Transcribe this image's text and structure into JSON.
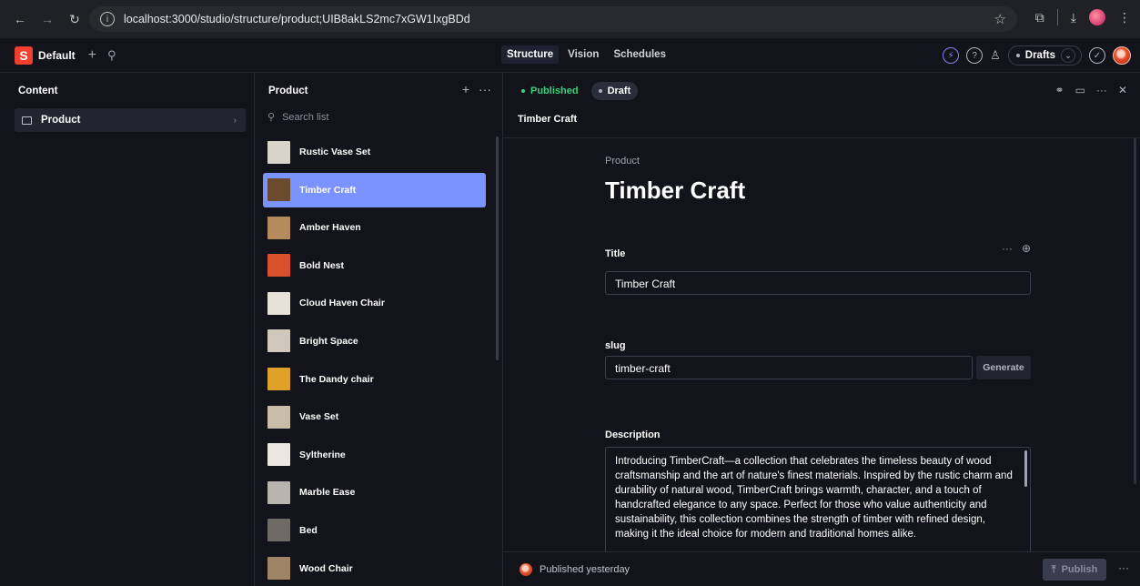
{
  "browser": {
    "url": "localhost:3000/studio/structure/product;UIB8akLS2mc7xGW1IxgBDd"
  },
  "app": {
    "workspace": "Default",
    "tabs": [
      "Structure",
      "Vision",
      "Schedules"
    ],
    "perspective": "Drafts"
  },
  "content_pane": {
    "title": "Content",
    "items": [
      {
        "label": "Product"
      }
    ]
  },
  "product_pane": {
    "title": "Product",
    "search_placeholder": "Search list",
    "items": [
      {
        "label": "Rustic Vase Set",
        "thumb": "#d8d4cc"
      },
      {
        "label": "Timber Craft",
        "thumb": "#6b4a2e",
        "selected": true
      },
      {
        "label": "Amber Haven",
        "thumb": "#b58a5c"
      },
      {
        "label": "Bold Nest",
        "thumb": "#d9502c"
      },
      {
        "label": "Cloud Haven Chair",
        "thumb": "#e6e2da"
      },
      {
        "label": "Bright Space",
        "thumb": "#cfc8bb"
      },
      {
        "label": "The Dandy chair",
        "thumb": "#e0a128"
      },
      {
        "label": "Vase Set",
        "thumb": "#c9bca8"
      },
      {
        "label": "Syltherine",
        "thumb": "#ebe7e0"
      },
      {
        "label": "Marble Ease",
        "thumb": "#b7b4ad"
      },
      {
        "label": "Bed",
        "thumb": "#6e6a66"
      },
      {
        "label": "Wood Chair",
        "thumb": "#a08466"
      }
    ]
  },
  "document": {
    "status_published": "Published",
    "status_draft": "Draft",
    "breadcrumb": "Timber Craft",
    "type": "Product",
    "title": "Timber Craft",
    "fields": {
      "title_label": "Title",
      "title_value": "Timber Craft",
      "slug_label": "slug",
      "slug_value": "timber-craft",
      "generate_label": "Generate",
      "description_label": "Description",
      "description_value": "Introducing TimberCraft—a collection that celebrates the timeless beauty of wood craftsmanship and the art of nature's finest materials. Inspired by the rustic charm and durability of natural wood, TimberCraft brings warmth, character, and a touch of handcrafted elegance to any space. Perfect for those who value authenticity and sustainability, this collection combines the strength of timber with refined design, making it the ideal choice for modern and traditional homes alike."
    },
    "footer_status": "Published yesterday",
    "publish_label": "Publish"
  }
}
